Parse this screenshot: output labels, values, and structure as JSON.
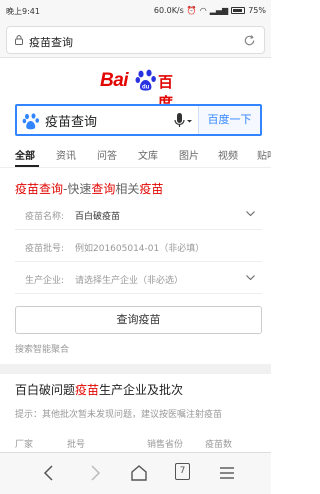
{
  "status_bar": {
    "time": "晚上9:41",
    "speed": "60.0K/s",
    "battery": "75%"
  },
  "url_bar": {
    "text": "疫苗查询"
  },
  "logo": {
    "latin": "Bai",
    "chinese": "百度",
    "color": "#e10602"
  },
  "search": {
    "value": "疫苗查询",
    "button_label": "百度一下",
    "accent": "#3385ff"
  },
  "tabs": [
    "全部",
    "资讯",
    "问答",
    "文库",
    "图片",
    "视频",
    "贴吧"
  ],
  "card": {
    "title_parts": [
      "疫苗查询",
      "-快速",
      "查询",
      "相关",
      "疫苗"
    ],
    "fields": [
      {
        "label": "疫苗名称:",
        "value": "百白破疫苗",
        "placeholder": ""
      },
      {
        "label": "疫苗批号:",
        "value": "",
        "placeholder": "例如201605014-01（非必填）"
      },
      {
        "label": "生产企业:",
        "value": "",
        "placeholder": "请选择生产企业（非必选）"
      }
    ],
    "query_button": "查询疫苗",
    "footer": "搜索智能聚合"
  },
  "result": {
    "title_parts": [
      "百白破问题",
      "疫苗",
      "生产企业及批次"
    ],
    "hint": "提示：其他批次暂未发现问题，建议按医嘱注射疫苗",
    "columns": [
      "厂家",
      "批号",
      "销售省份",
      "疫苗数"
    ]
  },
  "bottom_nav": {
    "tab_count": "7"
  }
}
